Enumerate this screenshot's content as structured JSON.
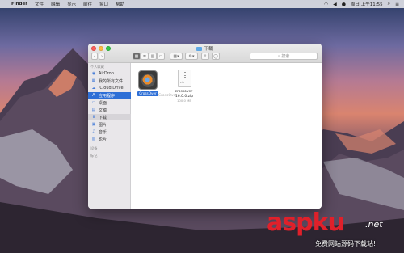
{
  "menubar": {
    "apple_glyph": "",
    "items": [
      "Finder",
      "文件",
      "编辑",
      "显示",
      "前往",
      "窗口",
      "帮助"
    ],
    "clock": "周日 上午11:55",
    "status_icons": [
      "wifi-icon",
      "volume-icon",
      "user-icon",
      "spotlight-icon",
      "list-icon"
    ]
  },
  "window": {
    "title": "下载",
    "nav_back": "‹",
    "nav_forward": "›",
    "search_placeholder": "搜索"
  },
  "sidebar": {
    "favorites_header": "个人收藏",
    "items": [
      {
        "label": "AirDrop",
        "icon": "airdrop-icon",
        "glyph": "◉",
        "selected": false
      },
      {
        "label": "我的所有文件",
        "icon": "all-files-icon",
        "glyph": "▦",
        "selected": false
      },
      {
        "label": "iCloud Drive",
        "icon": "cloud-icon",
        "glyph": "☁",
        "selected": false
      },
      {
        "label": "应用程序",
        "icon": "applications-icon",
        "glyph": "A",
        "selected": true
      },
      {
        "label": "桌面",
        "icon": "desktop-icon",
        "glyph": "▭",
        "selected": false
      },
      {
        "label": "文稿",
        "icon": "documents-icon",
        "glyph": "▤",
        "selected": false
      },
      {
        "label": "下载",
        "icon": "downloads-icon",
        "glyph": "⬇",
        "selected": false
      },
      {
        "label": "图片",
        "icon": "pictures-icon",
        "glyph": "▣",
        "selected": false
      },
      {
        "label": "音乐",
        "icon": "music-icon",
        "glyph": "♫",
        "selected": false
      },
      {
        "label": "影片",
        "icon": "movies-icon",
        "glyph": "▥",
        "selected": false
      }
    ],
    "devices_header": "设备",
    "tags_header": "标记"
  },
  "content": {
    "files": [
      {
        "name": "CrossOver",
        "kind": "app",
        "selected": true
      },
      {
        "name": "crossover-16.0.0.zip",
        "kind": "zip",
        "size": "100.0 MB"
      }
    ],
    "drag_ghost_label": "CrossOver"
  },
  "watermark": {
    "logo": "aspku",
    "suffix": ".net",
    "subtitle": "免费网站源码下载站!"
  },
  "colors": {
    "selection": "#2e6fd6",
    "watermark_red": "#e0202a"
  }
}
